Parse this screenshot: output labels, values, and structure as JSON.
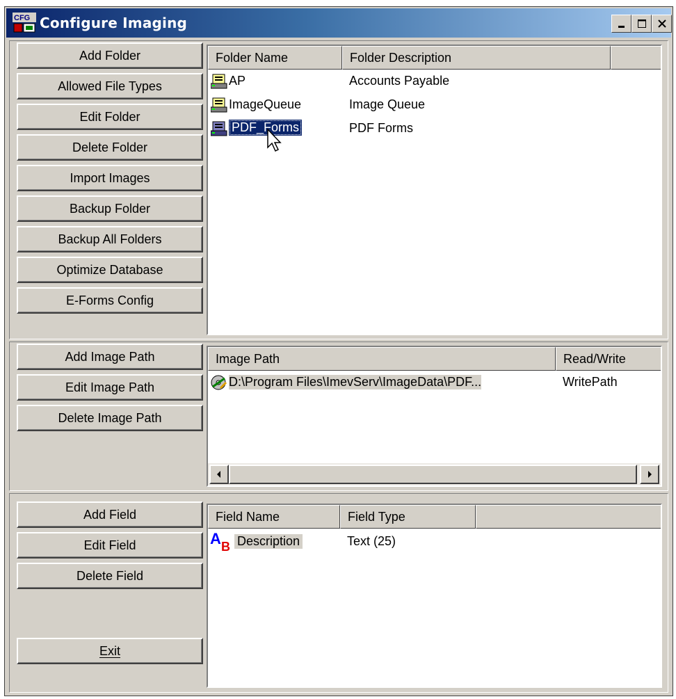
{
  "window": {
    "title": "Configure Imaging",
    "icon_name": "cfg-app-icon",
    "controls": [
      "minimize",
      "maximize",
      "close"
    ]
  },
  "folders_panel": {
    "buttons": [
      {
        "label": "Add Folder"
      },
      {
        "label": "Allowed File Types"
      },
      {
        "label": "Edit Folder"
      },
      {
        "label": "Delete Folder"
      },
      {
        "label": "Import Images"
      },
      {
        "label": "Backup Folder"
      },
      {
        "label": "Backup All Folders"
      },
      {
        "label": "Optimize Database"
      },
      {
        "label": "E-Forms Config"
      }
    ],
    "columns": [
      "Folder Name",
      "Folder Description"
    ],
    "rows": [
      {
        "name": "AP",
        "description": "Accounts Payable",
        "icon": "folder-server-icon"
      },
      {
        "name": "ImageQueue",
        "description": "Image Queue",
        "icon": "folder-server-icon"
      },
      {
        "name": "PDF_Forms",
        "description": "PDF Forms",
        "icon": "folder-server-icon",
        "selected": true
      }
    ]
  },
  "image_path_panel": {
    "buttons": [
      {
        "label": "Add Image Path"
      },
      {
        "label": "Edit Image Path"
      },
      {
        "label": "Delete Image Path"
      }
    ],
    "columns": [
      "Image Path",
      "Read/Write"
    ],
    "rows": [
      {
        "path": "D:\\Program Files\\ImevServ\\ImageData\\PDF...",
        "mode": "WritePath",
        "icon": "disk-path-icon"
      }
    ]
  },
  "fields_panel": {
    "buttons": [
      {
        "label": "Add Field"
      },
      {
        "label": "Edit Field"
      },
      {
        "label": "Delete Field"
      }
    ],
    "exit_label": "Exit",
    "columns": [
      "Field Name",
      "Field Type"
    ],
    "rows": [
      {
        "name": "Description",
        "type": "Text (25)",
        "icon": "text-field-icon"
      }
    ]
  },
  "colors": {
    "face": "#d4d0c8",
    "title_start": "#0a246a",
    "title_end": "#a6caf0",
    "selection": "#0a246a"
  }
}
